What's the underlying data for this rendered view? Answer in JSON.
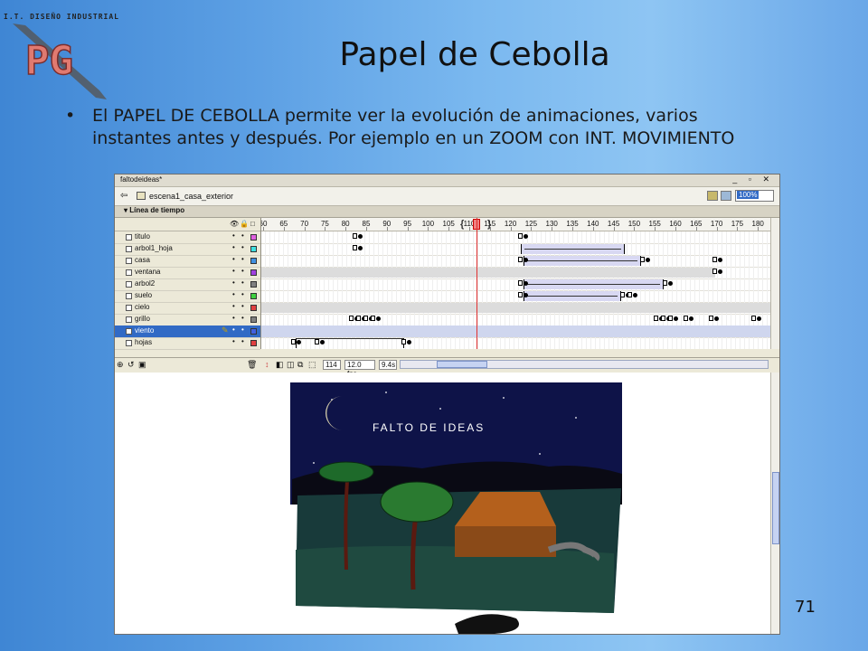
{
  "logo": {
    "top_text": "I.T. DISEÑO INDUSTRIAL",
    "mark_text": "PG"
  },
  "slide": {
    "title": "Papel de Cebolla",
    "bullet": "El PAPEL DE CEBOLLA permite ver la evolución de animaciones, varios instantes antes y después. Por ejemplo en un ZOOM con INT. MOVIMIENTO",
    "page_number": "71"
  },
  "flash": {
    "window_title": "faltodeideas*",
    "window_controls": "_ ▫ ✕",
    "back_arrow": "⇦",
    "scene_name": "escena1_casa_exterior",
    "zoom": "100%",
    "timeline_header": "▾ Línea de tiempo",
    "header_icons": {
      "eye": "👁",
      "lock": "🔒",
      "outline": "□"
    },
    "ruler_ticks": [
      "60",
      "65",
      "70",
      "75",
      "80",
      "85",
      "90",
      "95",
      "100",
      "105",
      "110",
      "115",
      "120",
      "125",
      "130",
      "135",
      "140",
      "145",
      "150",
      "155",
      "160",
      "165",
      "170",
      "175",
      "180",
      "18"
    ],
    "current_frame_marker": 115,
    "layers": [
      {
        "name": "titulo",
        "color": "#e060e0"
      },
      {
        "name": "arbol1_hoja",
        "color": "#40e0e0"
      },
      {
        "name": "casa",
        "color": "#4090e0"
      },
      {
        "name": "ventana",
        "color": "#a040e0"
      },
      {
        "name": "arbol2",
        "color": "#808080"
      },
      {
        "name": "suelo",
        "color": "#40d040"
      },
      {
        "name": "cielo",
        "color": "#e04040"
      },
      {
        "name": "grillo",
        "color": "#808080"
      },
      {
        "name": "viento",
        "color": "#4060e0",
        "selected": true
      },
      {
        "name": "hojas",
        "color": "#e04040"
      }
    ],
    "status": {
      "frame": "114",
      "fps": "12.0 fps",
      "time": "9.4s"
    },
    "stage_text": "FALTO  DE  IDEAS"
  }
}
